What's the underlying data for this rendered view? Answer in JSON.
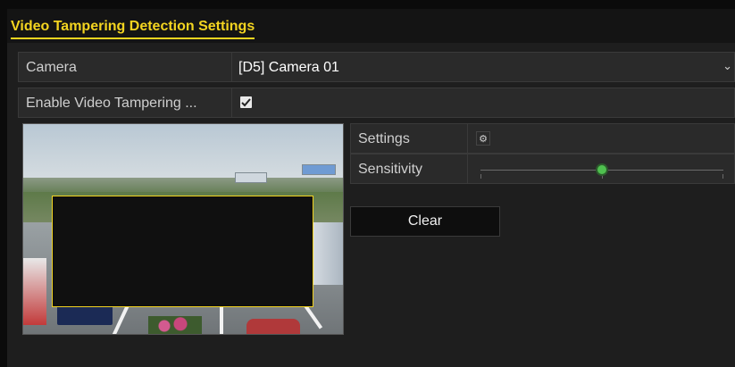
{
  "title": "Video Tampering Detection Settings",
  "camera": {
    "label": "Camera",
    "value": "[D5] Camera 01",
    "dropdown_icon": "chevron-down-icon"
  },
  "enable": {
    "label": "Enable Video Tampering ...",
    "checked": true,
    "check_icon": "checkmark-icon"
  },
  "settings": {
    "label": "Settings",
    "icon": "gear-icon"
  },
  "sensitivity": {
    "label": "Sensitivity",
    "level_fraction": 0.5
  },
  "clear": {
    "label": "Clear"
  },
  "colors": {
    "accent": "#f3d420",
    "slider_thumb": "#4fc04f",
    "background": "#1e1e1e"
  }
}
